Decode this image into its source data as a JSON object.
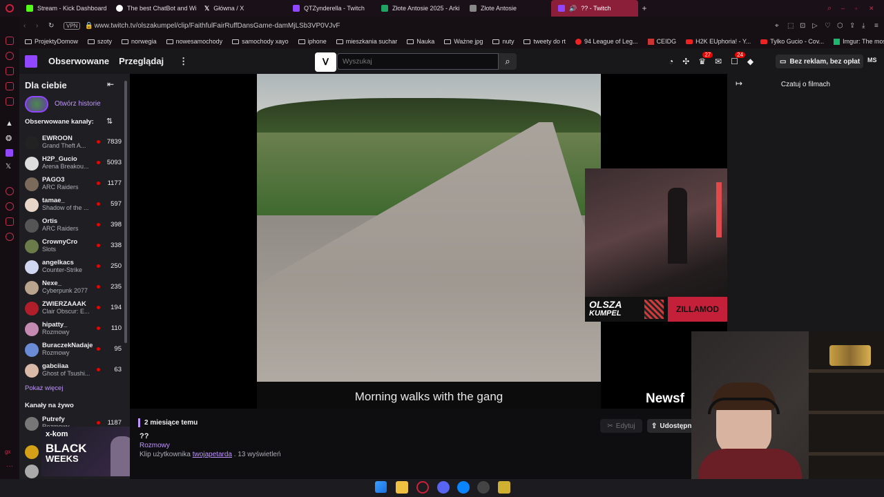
{
  "browser": {
    "tabs": [
      {
        "label": "Stream - Kick Dashboard",
        "color": "#53fc18"
      },
      {
        "label": "The best ChatBot and Wi",
        "color": "#ffffff"
      },
      {
        "label": "Główna / X",
        "color": "#ffffff"
      },
      {
        "label": "QTZynderella - Twitch",
        "color": "#9146ff"
      },
      {
        "label": "Złote Antosie 2025 - Arki",
        "color": "#1fa463"
      },
      {
        "label": "Złote Antosie",
        "color": "#888888"
      },
      {
        "label": "?? - Twitch",
        "color": "#9146ff"
      }
    ],
    "vpn": "VPN",
    "url": "www.twitch.tv/olszakumpel/clip/FaithfulFairRuffDansGame-damMjLSb3VP0VJvF",
    "bookmarks": [
      "ProjektyDomow",
      "szoty",
      "norwegia",
      "nowesamochody",
      "samochody xayo",
      "iphone",
      "mieszkania suchar",
      "Nauka",
      "Ważne jpg",
      "nuty",
      "tweety do rt",
      "94 League of Leg...",
      "CEIDG",
      "H2K EUphoria! - Y...",
      "Tylko Gucio - Cov...",
      "Imgur: The most a..."
    ]
  },
  "topnav": {
    "following": "Obserwowane",
    "browse": "Przeglądaj",
    "search_placeholder": "Wyszukaj",
    "badge_inbox": "27",
    "badge_notif": "24",
    "no_ads": "Bez reklam, bez opłat",
    "user_initials": "MS"
  },
  "sidebar": {
    "title": "Dla ciebie",
    "stories": "Otwórz historie",
    "followed_header": "Obserwowane kanały:",
    "followed": [
      {
        "name": "EWROON",
        "game": "Grand Theft A...",
        "viewers": "7839",
        "color": "#222"
      },
      {
        "name": "H2P_Gucio",
        "game": "Arena Breakou...",
        "viewers": "5093",
        "color": "#ddd"
      },
      {
        "name": "PAGO3",
        "game": "ARC Raiders",
        "viewers": "1177",
        "color": "#7a6a5a"
      },
      {
        "name": "tamae_",
        "game": "Shadow of the ...",
        "viewers": "597",
        "color": "#e8d7c8"
      },
      {
        "name": "Ortis",
        "game": "ARC Raiders",
        "viewers": "398",
        "color": "#555"
      },
      {
        "name": "CrownyCro",
        "game": "Slots",
        "viewers": "338",
        "color": "#6b7c4a"
      },
      {
        "name": "angelkacs",
        "game": "Counter-Strike",
        "viewers": "250",
        "color": "#cfd8f0"
      },
      {
        "name": "Nexe_",
        "game": "Cyberpunk 2077",
        "viewers": "235",
        "color": "#b9a58d"
      },
      {
        "name": "ZWIERZAAAK",
        "game": "Clair Obscur: E...",
        "viewers": "194",
        "color": "#b01e2a"
      },
      {
        "name": "hipatty_",
        "game": "Rozmowy",
        "viewers": "110",
        "color": "#c48ab2"
      },
      {
        "name": "BuraczekNadaje",
        "game": "Rozmowy",
        "viewers": "95",
        "color": "#6a8bd6"
      },
      {
        "name": "gabciiaa",
        "game": "Ghost of Tsushi...",
        "viewers": "63",
        "color": "#d9b9a8"
      }
    ],
    "show_more": "Pokaż więcej",
    "live_header": "Kanały na żywo",
    "live": [
      {
        "name": "Putrefy",
        "game": "Rozmowy",
        "viewers": "1187",
        "color": "#777"
      }
    ],
    "ad": {
      "brand": "x-kom",
      "line1": "BLACK",
      "line2": "WEEKS"
    }
  },
  "chat": {
    "title": "Czatuj o filmach"
  },
  "video": {
    "subtitle": "Morning walks with the gang",
    "overlay_name1": "OLSZA",
    "overlay_name2": "KUMPEL",
    "overlay_tag": "ZILLAMOD",
    "newsfeed": "Newsf"
  },
  "clip_info": {
    "time": "2 miesiące temu",
    "title": "??",
    "category": "Rozmowy",
    "clip_by_prefix": "Klip użytkownika",
    "clip_author": "twojapetarda",
    "views": ". 13 wyświetleń",
    "edit": "Edytuj",
    "share": "Udostępn"
  }
}
